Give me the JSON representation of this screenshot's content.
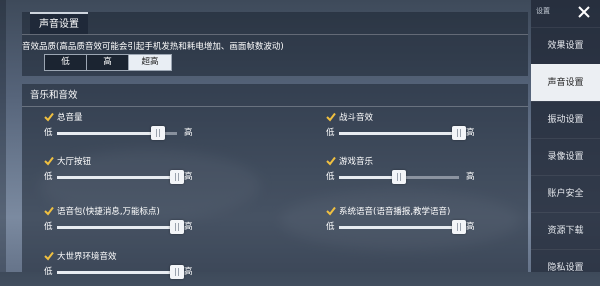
{
  "sound_panel": {
    "tab_label": "声音设置",
    "quality": {
      "description": "音效品质(高品质音效可能会引起手机发热和耗电增加、画面帧数波动)",
      "options": [
        "低",
        "高",
        "超高"
      ],
      "selected": "超高"
    }
  },
  "music_panel": {
    "tab_label": "音乐和音效",
    "low_label": "低",
    "high_label": "高",
    "items": [
      {
        "label": "总音量",
        "checked": true,
        "level": 0.84
      },
      {
        "label": "战斗音效",
        "checked": true,
        "level": 1.0
      },
      {
        "label": "大厅按钮",
        "checked": true,
        "level": 1.0
      },
      {
        "label": "游戏音乐",
        "checked": true,
        "level": 0.5
      },
      {
        "label": "语音包(快捷消息,万能标点)",
        "checked": true,
        "level": 1.0
      },
      {
        "label": "系统语音(语音播报,教学语音)",
        "checked": true,
        "level": 1.0
      },
      {
        "label": "大世界环境音效",
        "checked": true,
        "level": 1.0
      }
    ]
  },
  "sidebar": {
    "title": "设置",
    "items": [
      {
        "label": "效果设置",
        "active": false
      },
      {
        "label": "声音设置",
        "active": true
      },
      {
        "label": "振动设置",
        "active": false
      },
      {
        "label": "录像设置",
        "active": false
      },
      {
        "label": "账户安全",
        "active": false
      },
      {
        "label": "资源下载",
        "active": false
      },
      {
        "label": "隐私设置",
        "active": false
      }
    ]
  },
  "colors": {
    "accent": "#e8ecf1",
    "check": "#f0c040"
  }
}
